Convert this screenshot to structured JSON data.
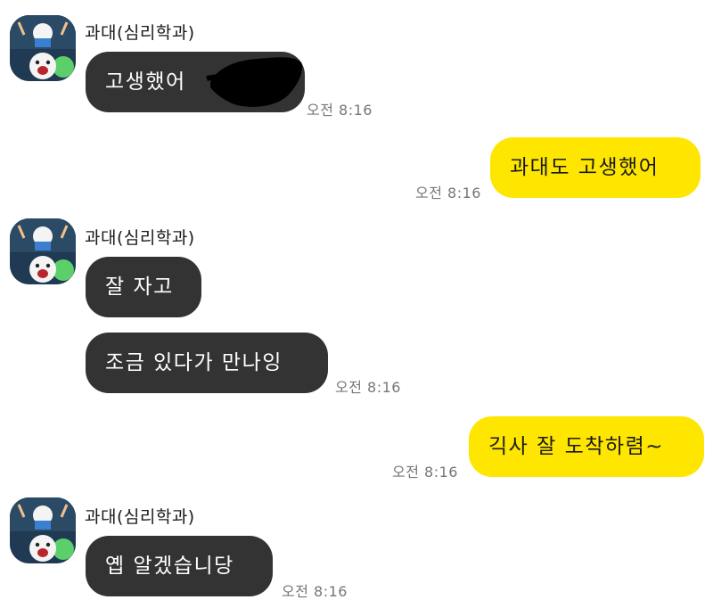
{
  "sender_name": "과대(심리학과)",
  "colors": {
    "incoming_bubble": "#333333",
    "outgoing_bubble": "#fee600",
    "background": "#ffffff",
    "timestamp": "#777777"
  },
  "messages": [
    {
      "direction": "incoming",
      "text": "고생했어",
      "redacted_suffix": true,
      "time": "오전 8:16"
    },
    {
      "direction": "outgoing",
      "text": "과대도 고생했어",
      "time": "오전 8:16"
    },
    {
      "direction": "incoming",
      "text": "잘 자고"
    },
    {
      "direction": "incoming",
      "text": "조금 있다가 만나잉",
      "time": "오전 8:16"
    },
    {
      "direction": "outgoing",
      "text": "긱사 잘 도착하렴~",
      "time": "오전 8:16"
    },
    {
      "direction": "incoming",
      "text": "옙 알겠습니당",
      "time": "오전 8:16"
    }
  ],
  "avatar_icon": "cartoon-character-icon"
}
